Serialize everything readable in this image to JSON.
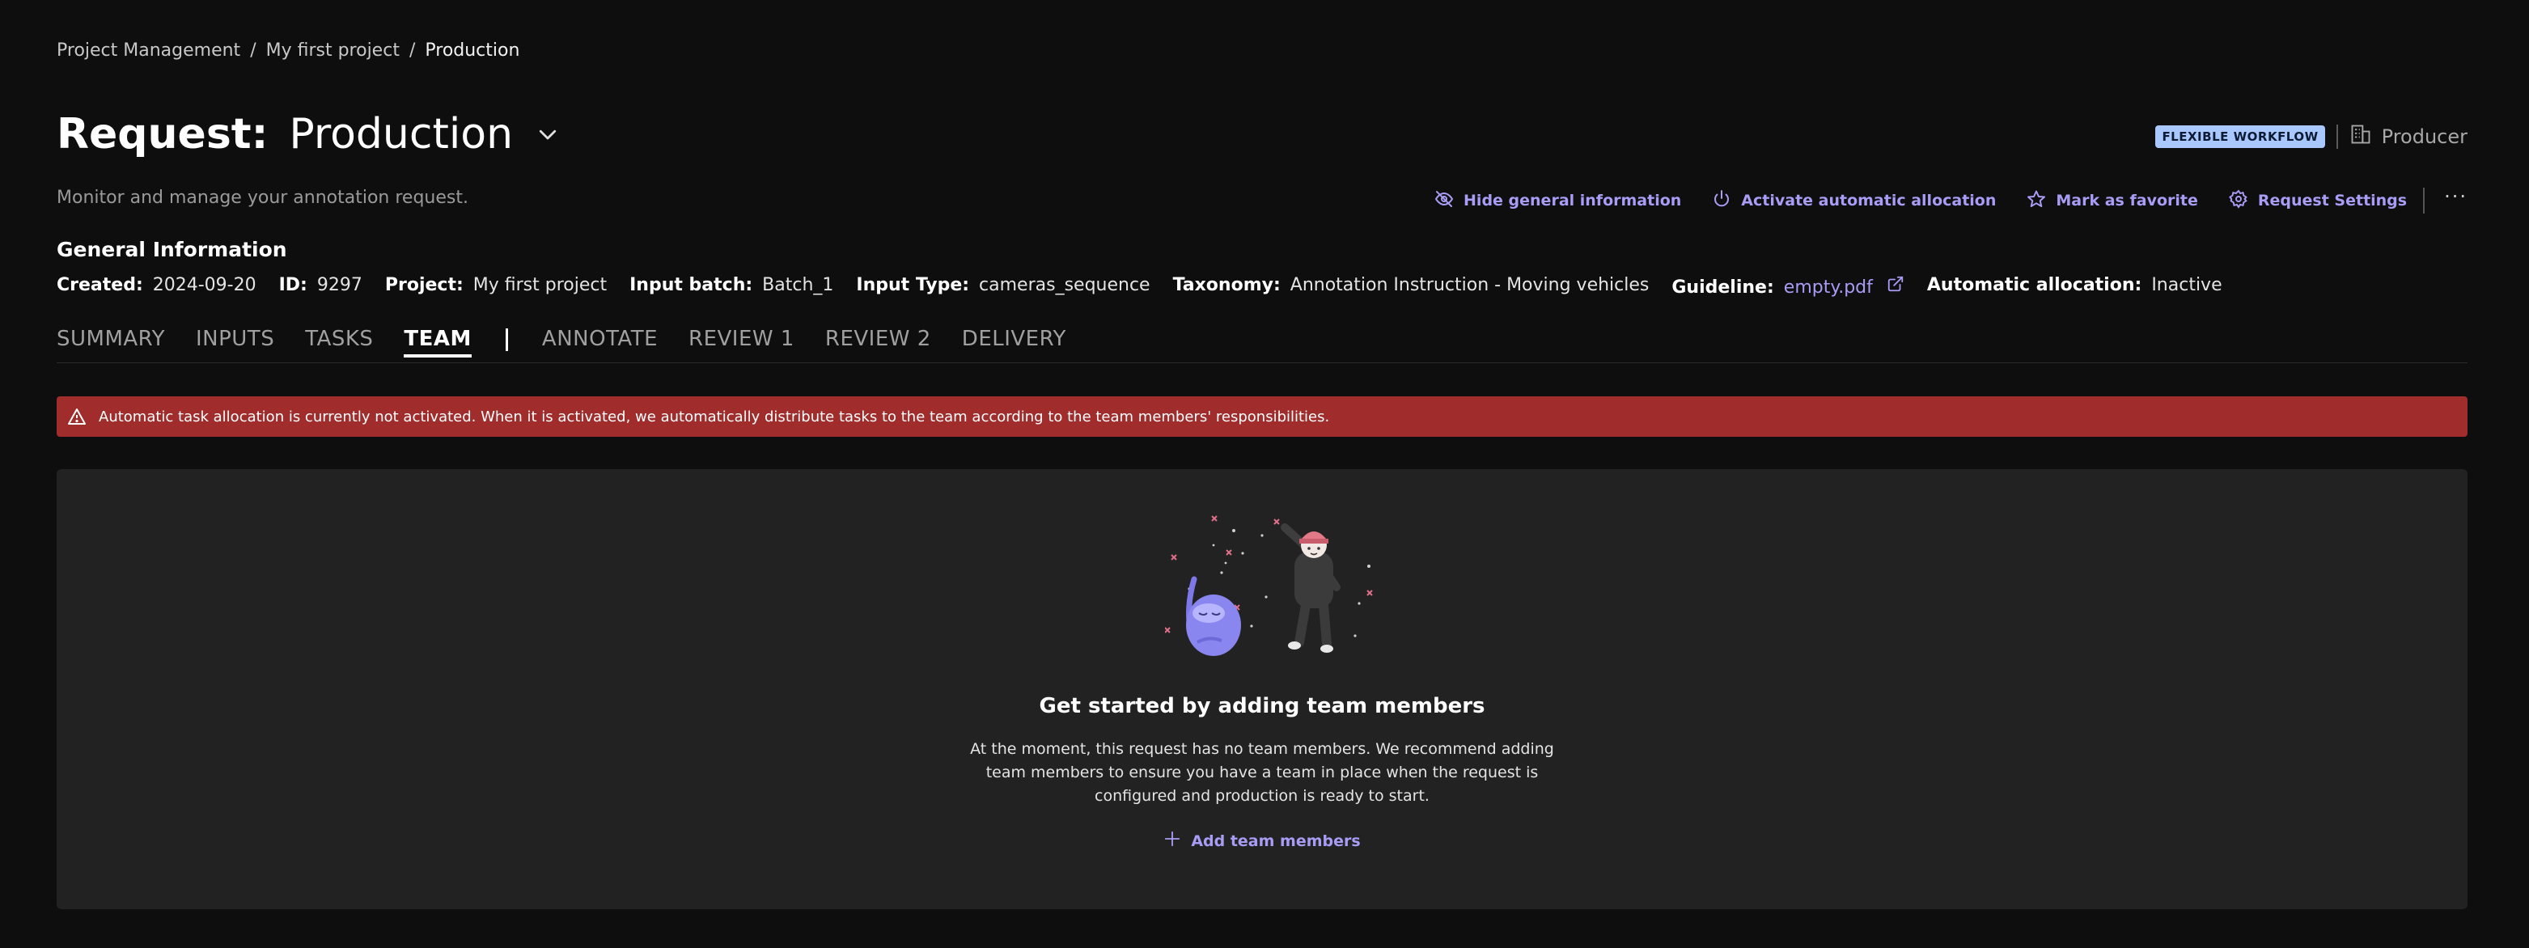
{
  "breadcrumb": {
    "items": [
      "Project Management",
      "My first project",
      "Production"
    ],
    "separator": "/"
  },
  "header": {
    "title_prefix": "Request:",
    "title_value": "Production",
    "subtitle": "Monitor and manage your annotation request.",
    "badge": "FLEXIBLE WORKFLOW",
    "role": "Producer"
  },
  "actions": {
    "hide_info": "Hide general information",
    "activate_allocation": "Activate automatic allocation",
    "favorite": "Mark as favorite",
    "settings": "Request Settings",
    "more": "···"
  },
  "general_info": {
    "title": "General Information",
    "created_label": "Created:",
    "created_value": "2024-09-20",
    "id_label": "ID:",
    "id_value": "9297",
    "project_label": "Project:",
    "project_value": "My first project",
    "batch_label": "Input batch:",
    "batch_value": "Batch_1",
    "input_type_label": "Input Type:",
    "input_type_value": "cameras_sequence",
    "taxonomy_label": "Taxonomy:",
    "taxonomy_value": "Annotation Instruction - Moving vehicles",
    "guideline_label": "Guideline:",
    "guideline_value": "empty.pdf",
    "allocation_label": "Automatic allocation:",
    "allocation_value": "Inactive"
  },
  "tabs": {
    "summary": "SUMMARY",
    "inputs": "INPUTS",
    "tasks": "TASKS",
    "team": "TEAM",
    "annotate": "ANNOTATE",
    "review1": "REVIEW 1",
    "review2": "REVIEW 2",
    "delivery": "DELIVERY"
  },
  "alert": {
    "text": "Automatic task allocation is currently not activated. When it is activated, we automatically distribute tasks to the team according to the team members' responsibilities."
  },
  "empty_state": {
    "title": "Get started by adding team members",
    "description": "At the moment, this request has no team members. We recommend adding team members to ensure you have a team in place when the request is configured and production is ready to start.",
    "button": "Add team members"
  },
  "colors": {
    "accent": "#a89cf5",
    "alert_bg": "#a12c2c",
    "badge_bg": "#a9c8ff",
    "page_bg": "#0e0e0f",
    "panel_bg": "#222222"
  }
}
